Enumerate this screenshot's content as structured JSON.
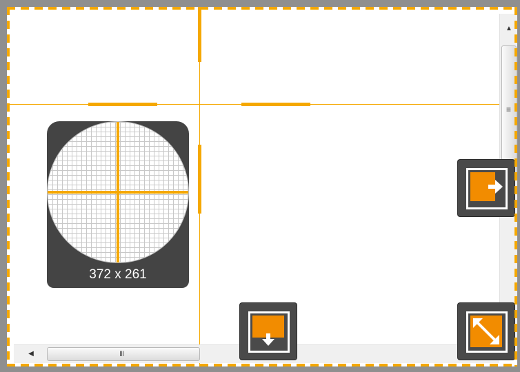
{
  "magnifier": {
    "size_label": "372 x 261"
  },
  "scrollbar": {
    "up_arrow": "▲",
    "left_arrow": "◀",
    "v_grip": "≡",
    "h_grip": "III"
  },
  "buttons": {
    "capture_right": {
      "icon": "expand-right-icon"
    },
    "capture_down": {
      "icon": "expand-down-icon"
    },
    "capture_both": {
      "icon": "expand-both-icon"
    }
  },
  "colors": {
    "accent": "#f5a800",
    "button_bg": "#4a4a4a",
    "icon_fill": "#f28c00"
  }
}
